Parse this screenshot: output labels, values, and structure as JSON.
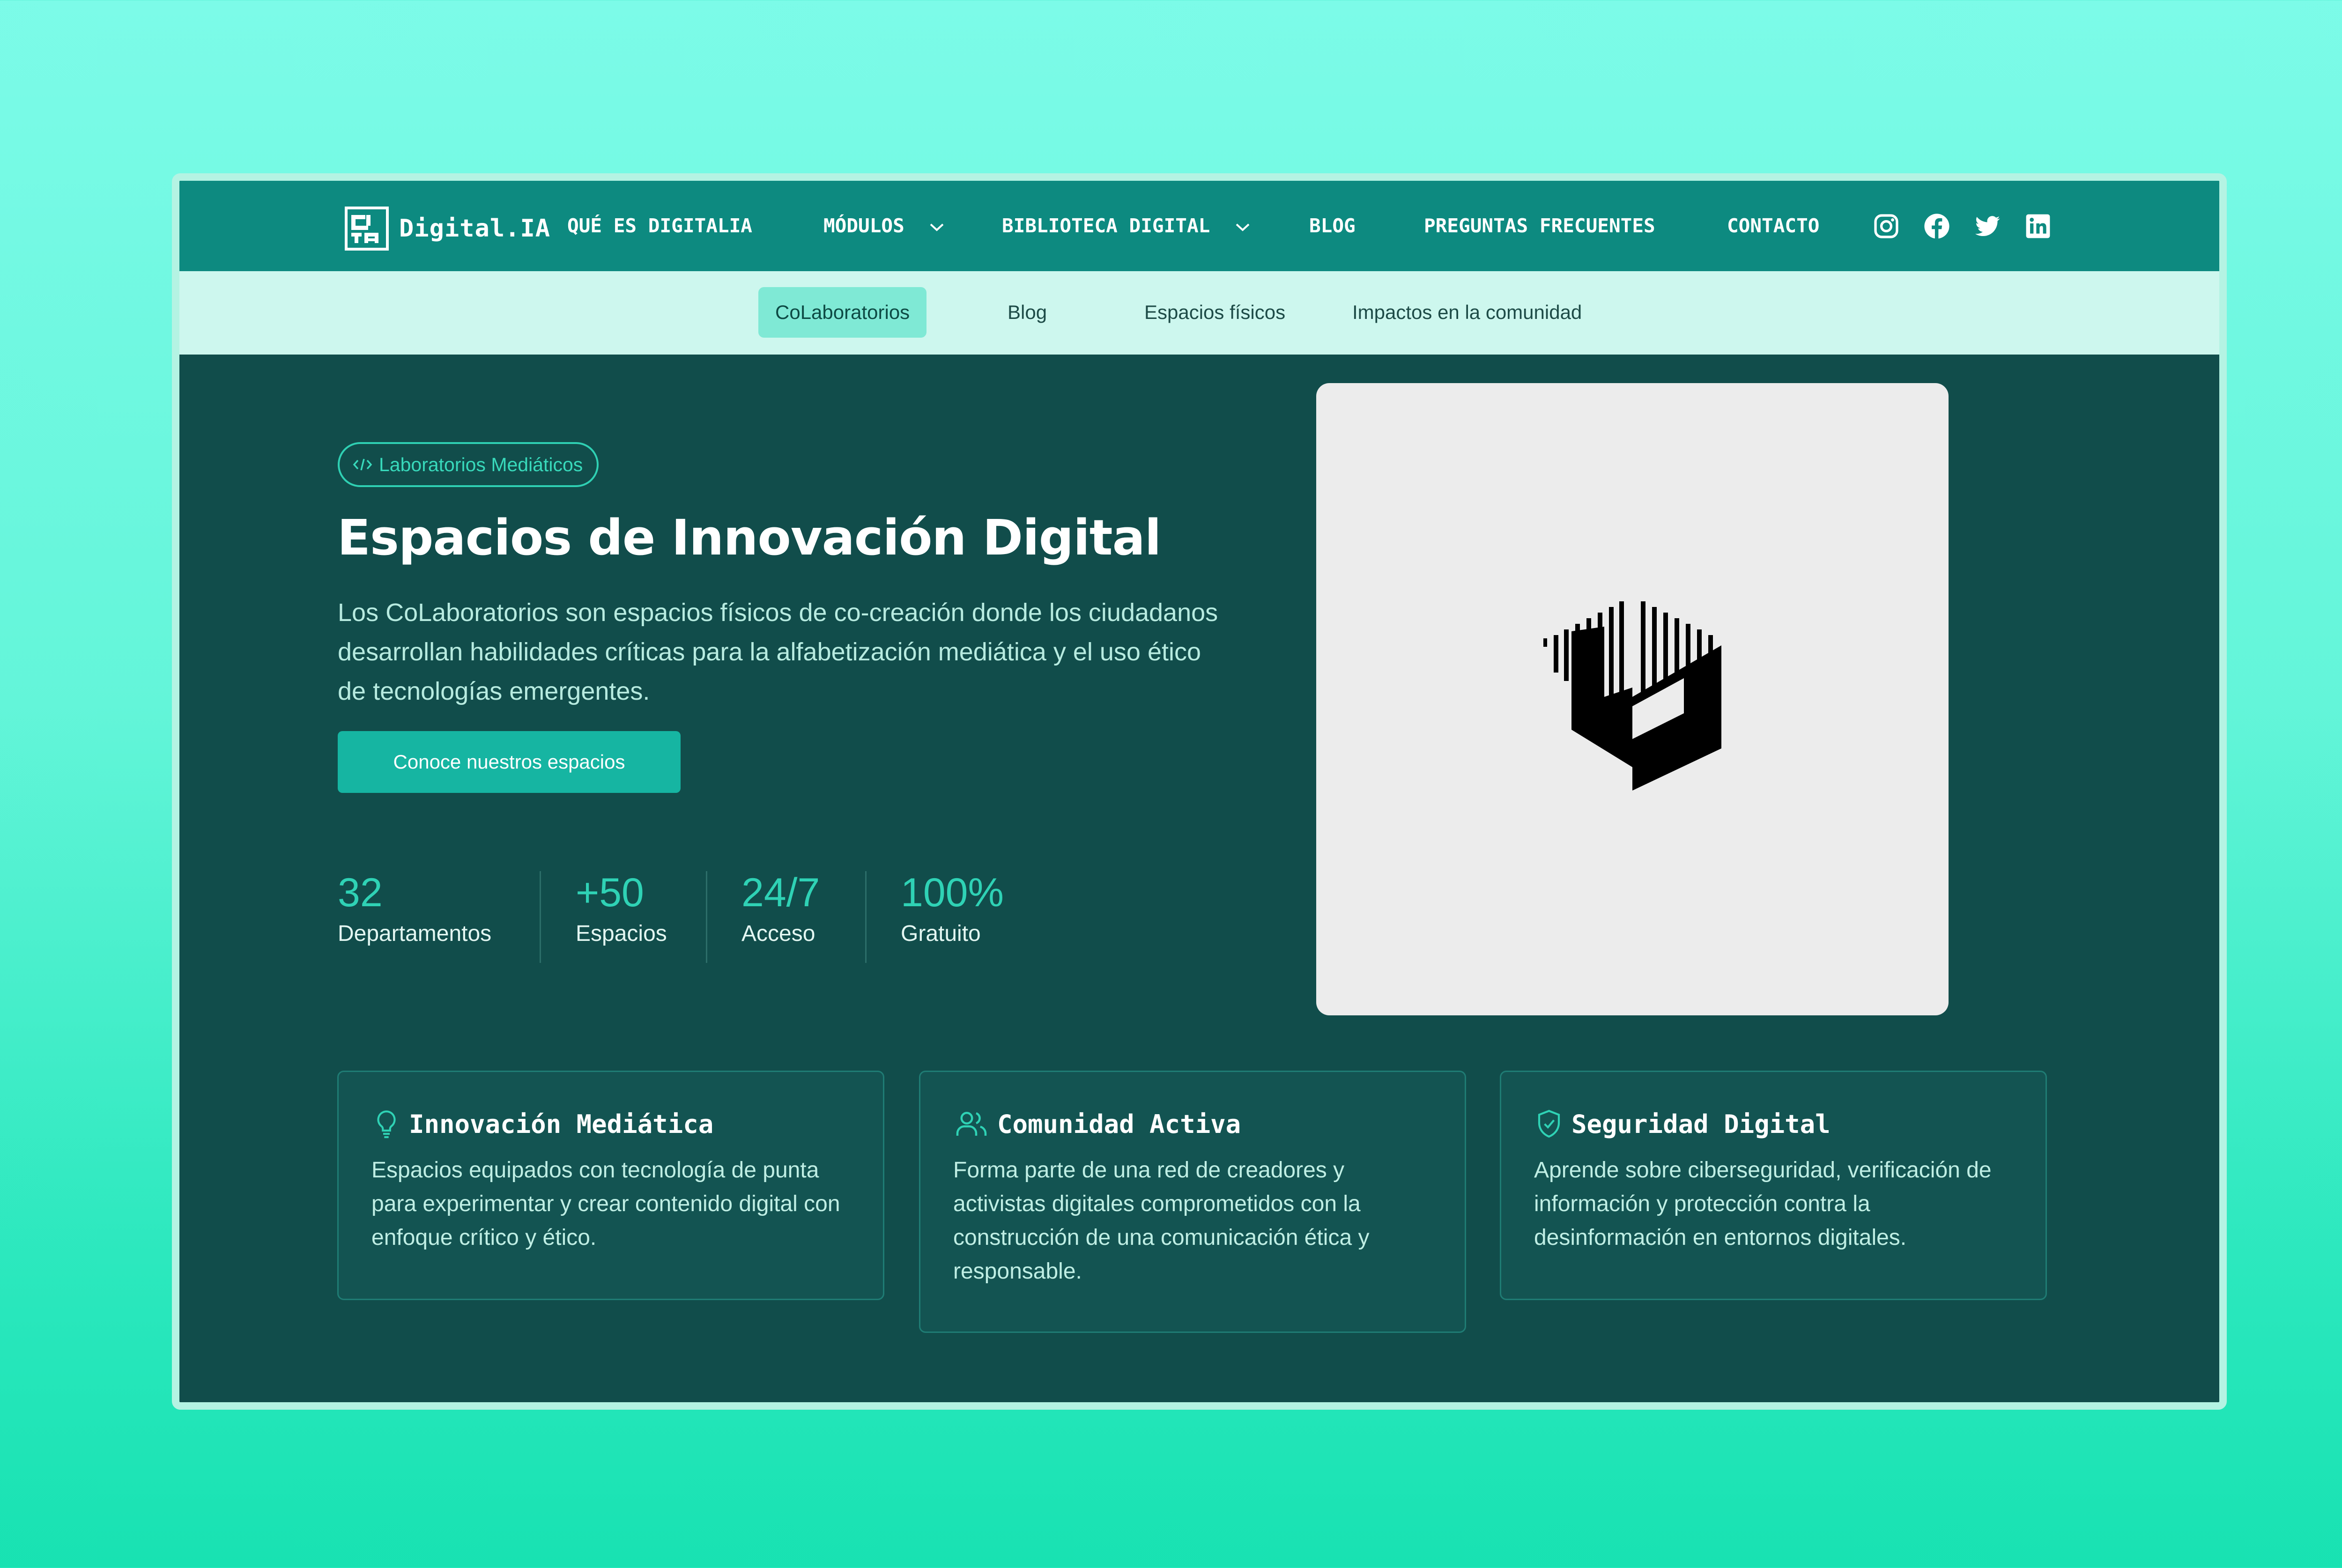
{
  "brand": {
    "logo_text": "Digital.IA"
  },
  "nav": {
    "items": [
      {
        "label": "QUÉ ES DIGITALIA"
      },
      {
        "label": "MÓDULOS"
      },
      {
        "label": "BIBLIOTECA DIGITAL"
      },
      {
        "label": "BLOG"
      },
      {
        "label": "PREGUNTAS FRECUENTES"
      },
      {
        "label": "CONTACTO"
      }
    ],
    "social_icons": [
      "instagram-icon",
      "facebook-icon",
      "twitter-icon",
      "linkedin-icon"
    ]
  },
  "subnav": {
    "tabs": [
      {
        "label": "CoLaboratorios",
        "active": true
      },
      {
        "label": "Blog",
        "active": false
      },
      {
        "label": "Espacios físicos",
        "active": false
      },
      {
        "label": "Impactos en la comunidad",
        "active": false
      }
    ]
  },
  "hero": {
    "tag": "Laboratorios Mediáticos",
    "title": "Espacios de Innovación Digital",
    "description": "Los CoLaboratorios son espacios físicos de co-creación donde los ciudadanos desarrollan habilidades críticas para la alfabetización mediática y el uso ético de tecnologías emergentes.",
    "cta_label": "Conoce nuestros espacios",
    "stats": [
      {
        "value": "32",
        "label": "Departamentos"
      },
      {
        "value": "+50",
        "label": "Espacios"
      },
      {
        "value": "24/7",
        "label": "Acceso"
      },
      {
        "value": "100%",
        "label": "Gratuito"
      }
    ]
  },
  "cards": [
    {
      "icon": "lightbulb-icon",
      "title": "Innovación Mediática",
      "text": "Espacios equipados con tecnología de punta para experimentar y crear contenido digital con enfoque crítico y ético."
    },
    {
      "icon": "users-icon",
      "title": "Comunidad Activa",
      "text": "Forma parte de una red de creadores y activistas digitales comprometidos con la construcción de una comunicación ética y responsable."
    },
    {
      "icon": "shield-check-icon",
      "title": "Seguridad Digital",
      "text": "Aprende sobre ciberseguridad, verificación de información y protección contra la desinformación en entornos digitales."
    }
  ],
  "colors": {
    "page_bg": "#5ff4d6",
    "nav_bg": "#0d8a80",
    "subnav_bg": "#cdf7ee",
    "active_tab_bg": "#7fe9d5",
    "hero_bg": "#114d4b",
    "accent": "#2fd2b5",
    "button_bg": "#16b5a2",
    "card_bg": "#135452",
    "image_bg": "#ececec"
  }
}
